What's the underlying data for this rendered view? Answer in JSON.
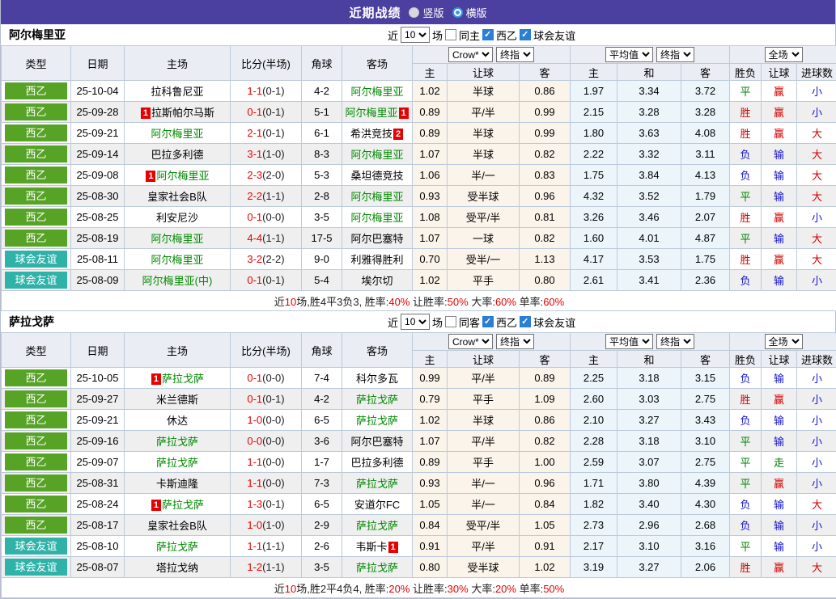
{
  "titlebar": {
    "title": "近期战绩",
    "vertical_label": "竖版",
    "horizontal_label": "横版",
    "selected_layout": "横版"
  },
  "chrome": {
    "near": "近",
    "count": "10",
    "games": "场",
    "league_label": "西乙",
    "friendly_label": "球会友谊",
    "league_checked": true,
    "friendly_checked": true,
    "same_checked": false,
    "selects": {
      "book": "Crow*",
      "final1": "终指",
      "avg": "平均值",
      "final2": "终指",
      "scope": "全场"
    },
    "main_columns": [
      "类型",
      "日期",
      "主场",
      "比分(半场)",
      "角球",
      "客场"
    ],
    "sub_columns": [
      "主",
      "让球",
      "客",
      "主",
      "和",
      "客",
      "胜负",
      "让球",
      "进球数"
    ]
  },
  "colors": {
    "topbar_purple": "#4b3fa0",
    "league_green": "#57a326",
    "friendly_teal": "#2fb3a9",
    "team_highlight_green": "#008800",
    "score_red": "#e60000",
    "win_red": "#d10000",
    "lose_blue": "#1414cc",
    "draw_green": "#008000",
    "handicap_bg": "#fbf4ea",
    "average_bg": "#ebf5fa"
  },
  "tables": [
    {
      "team": "阿尔梅里亚",
      "same_label": "同主",
      "rows": [
        {
          "type": "西乙",
          "type_kind": "league",
          "date": "25-10-04",
          "home_card": "",
          "home": "拉科鲁尼亚",
          "home_hl": false,
          "score": "1-1",
          "half": "(0-1)",
          "corner": "4-2",
          "away": "阿尔梅里亚",
          "away_hl": true,
          "away_card": "",
          "h1": "1.02",
          "h2": "半球",
          "h3": "0.86",
          "a1": "1.97",
          "a2": "3.34",
          "a3": "3.72",
          "r1": "平",
          "r2": "赢",
          "r3": "小"
        },
        {
          "type": "西乙",
          "type_kind": "league",
          "date": "25-09-28",
          "home_card": "1",
          "home": "拉斯帕尔马斯",
          "home_hl": false,
          "score": "0-1",
          "half": "(0-1)",
          "corner": "5-1",
          "away": "阿尔梅里亚",
          "away_hl": true,
          "away_card": "1",
          "h1": "0.89",
          "h2": "平/半",
          "h3": "0.99",
          "a1": "2.15",
          "a2": "3.28",
          "a3": "3.28",
          "r1": "胜",
          "r2": "赢",
          "r3": "小"
        },
        {
          "type": "西乙",
          "type_kind": "league",
          "date": "25-09-21",
          "home_card": "",
          "home": "阿尔梅里亚",
          "home_hl": true,
          "score": "2-1",
          "half": "(0-1)",
          "corner": "6-1",
          "away": "希洪竞技",
          "away_hl": false,
          "away_card": "2",
          "h1": "0.89",
          "h2": "半球",
          "h3": "0.99",
          "a1": "1.80",
          "a2": "3.63",
          "a3": "4.08",
          "r1": "胜",
          "r2": "赢",
          "r3": "大"
        },
        {
          "type": "西乙",
          "type_kind": "league",
          "date": "25-09-14",
          "home_card": "",
          "home": "巴拉多利德",
          "home_hl": false,
          "score": "3-1",
          "half": "(1-0)",
          "corner": "8-3",
          "away": "阿尔梅里亚",
          "away_hl": true,
          "away_card": "",
          "h1": "1.07",
          "h2": "半球",
          "h3": "0.82",
          "a1": "2.22",
          "a2": "3.32",
          "a3": "3.11",
          "r1": "负",
          "r2": "输",
          "r3": "大"
        },
        {
          "type": "西乙",
          "type_kind": "league",
          "date": "25-09-08",
          "home_card": "1",
          "home": "阿尔梅里亚",
          "home_hl": true,
          "score": "2-3",
          "half": "(2-0)",
          "corner": "5-3",
          "away": "桑坦德竞技",
          "away_hl": false,
          "away_card": "",
          "h1": "1.06",
          "h2": "半/一",
          "h3": "0.83",
          "a1": "1.75",
          "a2": "3.84",
          "a3": "4.13",
          "r1": "负",
          "r2": "输",
          "r3": "大"
        },
        {
          "type": "西乙",
          "type_kind": "league",
          "date": "25-08-30",
          "home_card": "",
          "home": "皇家社会B队",
          "home_hl": false,
          "score": "2-2",
          "half": "(1-1)",
          "corner": "2-8",
          "away": "阿尔梅里亚",
          "away_hl": true,
          "away_card": "",
          "h1": "0.93",
          "h2": "受半球",
          "h3": "0.96",
          "a1": "4.32",
          "a2": "3.52",
          "a3": "1.79",
          "r1": "平",
          "r2": "输",
          "r3": "大"
        },
        {
          "type": "西乙",
          "type_kind": "league",
          "date": "25-08-25",
          "home_card": "",
          "home": "利安尼沙",
          "home_hl": false,
          "score": "0-1",
          "half": "(0-0)",
          "corner": "3-5",
          "away": "阿尔梅里亚",
          "away_hl": true,
          "away_card": "",
          "h1": "1.08",
          "h2": "受平/半",
          "h3": "0.81",
          "a1": "3.26",
          "a2": "3.46",
          "a3": "2.07",
          "r1": "胜",
          "r2": "赢",
          "r3": "小"
        },
        {
          "type": "西乙",
          "type_kind": "league",
          "date": "25-08-19",
          "home_card": "",
          "home": "阿尔梅里亚",
          "home_hl": true,
          "score": "4-4",
          "half": "(1-1)",
          "corner": "17-5",
          "away": "阿尔巴塞特",
          "away_hl": false,
          "away_card": "",
          "h1": "1.07",
          "h2": "一球",
          "h3": "0.82",
          "a1": "1.60",
          "a2": "4.01",
          "a3": "4.87",
          "r1": "平",
          "r2": "输",
          "r3": "大"
        },
        {
          "type": "球会友谊",
          "type_kind": "friendly",
          "date": "25-08-11",
          "home_card": "",
          "home": "阿尔梅里亚",
          "home_hl": true,
          "score": "3-2",
          "half": "(2-2)",
          "corner": "9-0",
          "away": "利雅得胜利",
          "away_hl": false,
          "away_card": "",
          "h1": "0.70",
          "h2": "受半/一",
          "h3": "1.13",
          "a1": "4.17",
          "a2": "3.53",
          "a3": "1.75",
          "r1": "胜",
          "r2": "赢",
          "r3": "大"
        },
        {
          "type": "球会友谊",
          "type_kind": "friendly",
          "date": "25-08-09",
          "home_card": "",
          "home": "阿尔梅里亚(中)",
          "home_hl": true,
          "score": "0-1",
          "half": "(0-1)",
          "corner": "5-4",
          "away": "埃尔切",
          "away_hl": false,
          "away_card": "",
          "h1": "1.02",
          "h2": "平手",
          "h3": "0.80",
          "a1": "2.61",
          "a2": "3.41",
          "a3": "2.36",
          "r1": "负",
          "r2": "输",
          "r3": "小"
        }
      ],
      "summary": [
        {
          "text": "近",
          "red": false
        },
        {
          "text": "10",
          "red": true
        },
        {
          "text": "场,胜4平3负3, 胜率:",
          "red": false
        },
        {
          "text": "40%",
          "red": true
        },
        {
          "text": " 让胜率:",
          "red": false
        },
        {
          "text": "50%",
          "red": true
        },
        {
          "text": " 大率:",
          "red": false
        },
        {
          "text": "60%",
          "red": true
        },
        {
          "text": " 单率:",
          "red": false
        },
        {
          "text": "60%",
          "red": true
        }
      ]
    },
    {
      "team": "萨拉戈萨",
      "same_label": "同客",
      "rows": [
        {
          "type": "西乙",
          "type_kind": "league",
          "date": "25-10-05",
          "home_card": "1",
          "home": "萨拉戈萨",
          "home_hl": true,
          "score": "0-1",
          "half": "(0-0)",
          "corner": "7-4",
          "away": "科尔多瓦",
          "away_hl": false,
          "away_card": "",
          "h1": "0.99",
          "h2": "平/半",
          "h3": "0.89",
          "a1": "2.25",
          "a2": "3.18",
          "a3": "3.15",
          "r1": "负",
          "r2": "输",
          "r3": "小"
        },
        {
          "type": "西乙",
          "type_kind": "league",
          "date": "25-09-27",
          "home_card": "",
          "home": "米兰德斯",
          "home_hl": false,
          "score": "0-1",
          "half": "(0-1)",
          "corner": "4-2",
          "away": "萨拉戈萨",
          "away_hl": true,
          "away_card": "",
          "h1": "0.79",
          "h2": "平手",
          "h3": "1.09",
          "a1": "2.60",
          "a2": "3.03",
          "a3": "2.75",
          "r1": "胜",
          "r2": "赢",
          "r3": "小"
        },
        {
          "type": "西乙",
          "type_kind": "league",
          "date": "25-09-21",
          "home_card": "",
          "home": "休达",
          "home_hl": false,
          "score": "1-0",
          "half": "(0-0)",
          "corner": "6-5",
          "away": "萨拉戈萨",
          "away_hl": true,
          "away_card": "",
          "h1": "1.02",
          "h2": "半球",
          "h3": "0.86",
          "a1": "2.10",
          "a2": "3.27",
          "a3": "3.43",
          "r1": "负",
          "r2": "输",
          "r3": "小"
        },
        {
          "type": "西乙",
          "type_kind": "league",
          "date": "25-09-16",
          "home_card": "",
          "home": "萨拉戈萨",
          "home_hl": true,
          "score": "0-0",
          "half": "(0-0)",
          "corner": "3-6",
          "away": "阿尔巴塞特",
          "away_hl": false,
          "away_card": "",
          "h1": "1.07",
          "h2": "平/半",
          "h3": "0.82",
          "a1": "2.28",
          "a2": "3.18",
          "a3": "3.10",
          "r1": "平",
          "r2": "输",
          "r3": "小"
        },
        {
          "type": "西乙",
          "type_kind": "league",
          "date": "25-09-07",
          "home_card": "",
          "home": "萨拉戈萨",
          "home_hl": true,
          "score": "1-1",
          "half": "(0-0)",
          "corner": "1-7",
          "away": "巴拉多利德",
          "away_hl": false,
          "away_card": "",
          "h1": "0.89",
          "h2": "平手",
          "h3": "1.00",
          "a1": "2.59",
          "a2": "3.07",
          "a3": "2.75",
          "r1": "平",
          "r2": "走",
          "r3": "小"
        },
        {
          "type": "西乙",
          "type_kind": "league",
          "date": "25-08-31",
          "home_card": "",
          "home": "卡斯迪隆",
          "home_hl": false,
          "score": "1-1",
          "half": "(0-0)",
          "corner": "7-3",
          "away": "萨拉戈萨",
          "away_hl": true,
          "away_card": "",
          "h1": "0.93",
          "h2": "半/一",
          "h3": "0.96",
          "a1": "1.71",
          "a2": "3.80",
          "a3": "4.39",
          "r1": "平",
          "r2": "赢",
          "r3": "小"
        },
        {
          "type": "西乙",
          "type_kind": "league",
          "date": "25-08-24",
          "home_card": "1",
          "home": "萨拉戈萨",
          "home_hl": true,
          "score": "1-3",
          "half": "(0-1)",
          "corner": "6-5",
          "away": "安道尔FC",
          "away_hl": false,
          "away_card": "",
          "h1": "1.05",
          "h2": "半/一",
          "h3": "0.84",
          "a1": "1.82",
          "a2": "3.40",
          "a3": "4.30",
          "r1": "负",
          "r2": "输",
          "r3": "大"
        },
        {
          "type": "西乙",
          "type_kind": "league",
          "date": "25-08-17",
          "home_card": "",
          "home": "皇家社会B队",
          "home_hl": false,
          "score": "1-0",
          "half": "(1-0)",
          "corner": "2-9",
          "away": "萨拉戈萨",
          "away_hl": true,
          "away_card": "",
          "h1": "0.84",
          "h2": "受平/半",
          "h3": "1.05",
          "a1": "2.73",
          "a2": "2.96",
          "a3": "2.68",
          "r1": "负",
          "r2": "输",
          "r3": "小"
        },
        {
          "type": "球会友谊",
          "type_kind": "friendly",
          "date": "25-08-10",
          "home_card": "",
          "home": "萨拉戈萨",
          "home_hl": true,
          "score": "1-1",
          "half": "(1-1)",
          "corner": "2-6",
          "away": "韦斯卡",
          "away_hl": false,
          "away_card": "1",
          "h1": "0.91",
          "h2": "平/半",
          "h3": "0.91",
          "a1": "2.17",
          "a2": "3.10",
          "a3": "3.16",
          "r1": "平",
          "r2": "输",
          "r3": "小"
        },
        {
          "type": "球会友谊",
          "type_kind": "friendly",
          "date": "25-08-07",
          "home_card": "",
          "home": "塔拉戈纳",
          "home_hl": false,
          "score": "1-2",
          "half": "(1-1)",
          "corner": "3-5",
          "away": "萨拉戈萨",
          "away_hl": true,
          "away_card": "",
          "h1": "0.80",
          "h2": "受半球",
          "h3": "1.02",
          "a1": "3.19",
          "a2": "3.27",
          "a3": "2.06",
          "r1": "胜",
          "r2": "赢",
          "r3": "大"
        }
      ],
      "summary": [
        {
          "text": "近",
          "red": false
        },
        {
          "text": "10",
          "red": true
        },
        {
          "text": "场,胜2平4负4, 胜率:",
          "red": false
        },
        {
          "text": "20%",
          "red": true
        },
        {
          "text": " 让胜率:",
          "red": false
        },
        {
          "text": "30%",
          "red": true
        },
        {
          "text": " 大率:",
          "red": false
        },
        {
          "text": "20%",
          "red": true
        },
        {
          "text": " 单率:",
          "red": false
        },
        {
          "text": "50%",
          "red": true
        }
      ]
    }
  ]
}
